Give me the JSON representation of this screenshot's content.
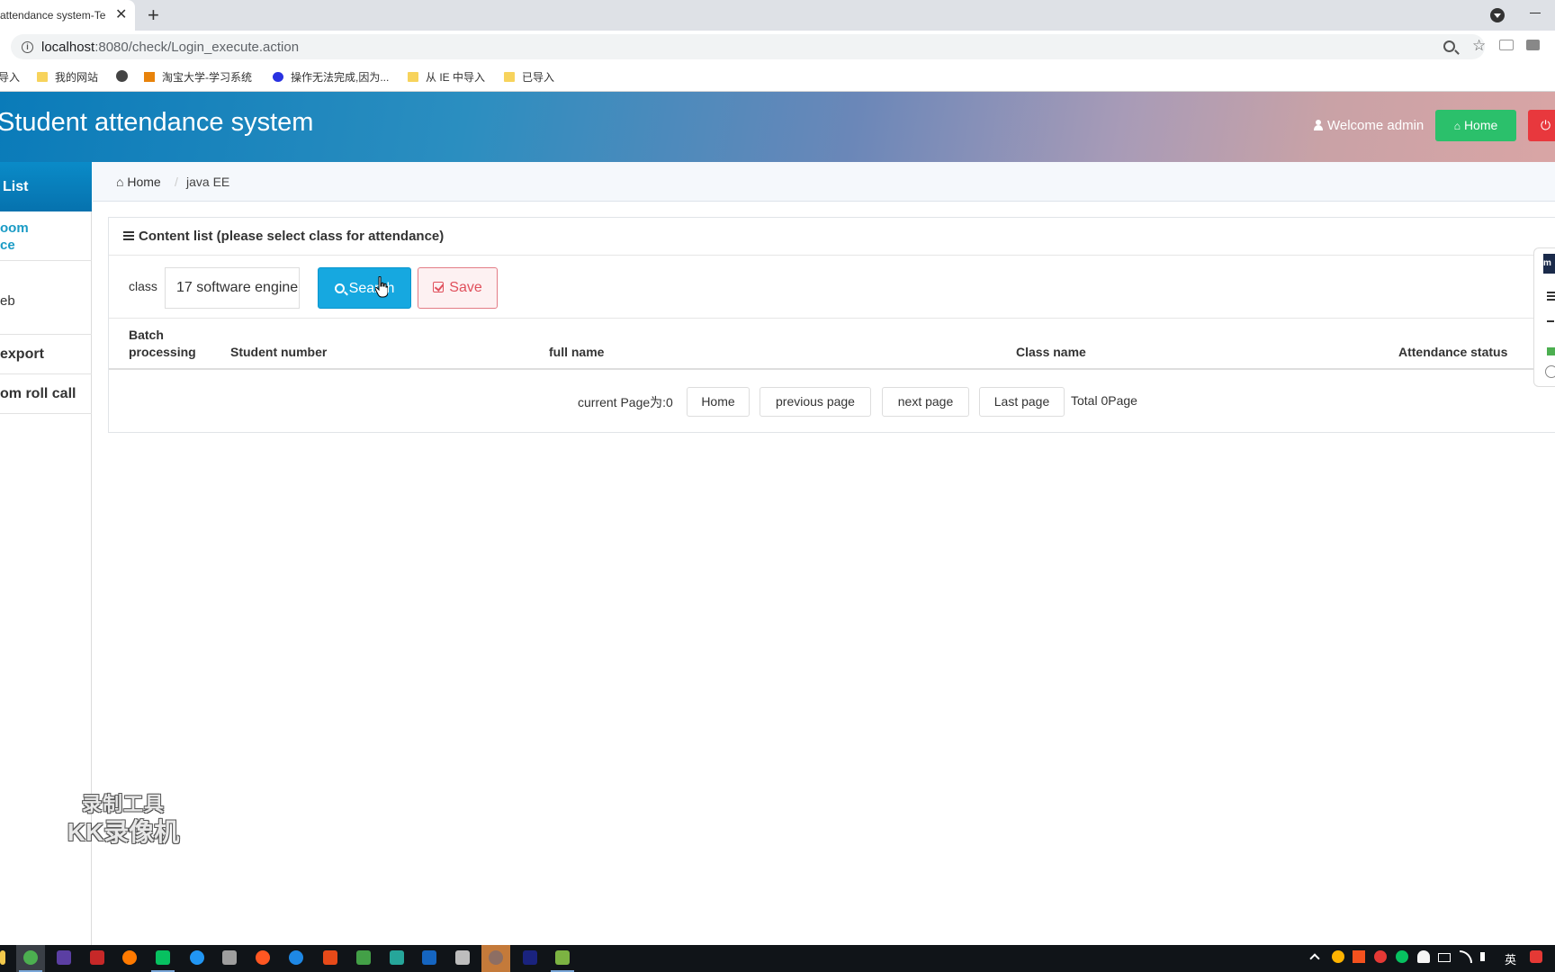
{
  "browser": {
    "tab_title": "attendance system-Te",
    "tab_close": "✕",
    "new_tab": "+",
    "url_host": "localhost",
    "url_path": ":8080/check/Login_execute.action",
    "star": "☆"
  },
  "bookmarks": [
    {
      "label": "导入",
      "icon": "none"
    },
    {
      "label": "我的网站",
      "icon": "folder"
    },
    {
      "label": "",
      "icon": "globe"
    },
    {
      "label": "淘宝大学-学习系统",
      "icon": "taobao"
    },
    {
      "label": "操作无法完成,因为...",
      "icon": "baidu"
    },
    {
      "label": "从 IE 中导入",
      "icon": "folder"
    },
    {
      "label": "已导入",
      "icon": "folder"
    }
  ],
  "header": {
    "title": "Student attendance system",
    "welcome": "Welcome admin",
    "home_button": "Home",
    "logout_icon": "⏻"
  },
  "sidebar": {
    "head": "List",
    "items": [
      {
        "label": "oom\nce"
      },
      {
        "label": "eb"
      },
      {
        "label": "export"
      },
      {
        "label": "om roll call"
      }
    ]
  },
  "breadcrumb": {
    "home": "Home",
    "separator": "/",
    "current": "java EE"
  },
  "panel": {
    "title": "Content list (please select class for attendance)",
    "class_label": "class",
    "class_value": "17 software engine",
    "search_button": "Search",
    "save_button": "Save"
  },
  "table": {
    "columns": [
      "Batch processing",
      "Student number",
      "full name",
      "Class name",
      "Attendance status"
    ],
    "rows": []
  },
  "pager": {
    "current_page_text": "current Page为:0",
    "home": "Home",
    "previous": "previous page",
    "next": "next page",
    "last": "Last page",
    "total_text": "Total 0Page"
  },
  "watermark": {
    "line1": "录制工具",
    "line2": "KK录像机"
  },
  "taskbar": {
    "ime": "英"
  },
  "colors": {
    "brand_blue": "#0a7bb9",
    "home_green": "#2bc06b",
    "logout_red": "#e8383d",
    "search_blue": "#16a8e0",
    "save_red": "#e0505c"
  }
}
